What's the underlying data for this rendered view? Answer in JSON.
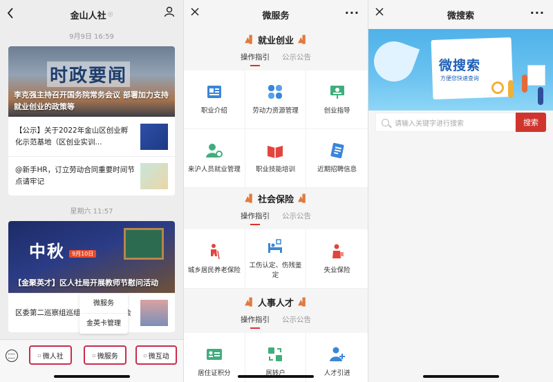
{
  "panel1": {
    "title": "金山人社",
    "time1": "9月9日 16:59",
    "hero1": {
      "big_text": "时政要闻",
      "title": "李克强主持召开国务院常务会议 部署加力支持就业创业的政策等"
    },
    "news1": [
      {
        "text": "【公示】关于2022年金山区创业孵化示范基地（区创业实训..."
      },
      {
        "text": "@新手HR，订立劳动合同重要时间节点请牢记"
      }
    ],
    "time2": "星期六 11:57",
    "hero2": {
      "big_text": "中秋",
      "tag": "9月10日",
      "title": "【金聚英才】区人社局开展教师节慰问活动"
    },
    "news2": [
      {
        "text": "区委第二巡察组巡组工作情况汇报会"
      }
    ],
    "popup": [
      "微服务",
      "金英卡管理"
    ],
    "menu": [
      "微人社",
      "微服务",
      "微互动"
    ]
  },
  "panel2": {
    "title": "微服务",
    "sections": [
      {
        "title": "就业创业",
        "tabs": [
          "操作指引",
          "公示公告"
        ],
        "items": [
          "职业介绍",
          "劳动力资源管理",
          "创业指导",
          "来沪人员就业管理",
          "职业技能培训",
          "近期招聘信息"
        ]
      },
      {
        "title": "社会保险",
        "tabs": [
          "操作指引",
          "公示公告"
        ],
        "items": [
          "城乡居民养老保险",
          "工伤认定、伤残鉴定",
          "失业保险"
        ]
      },
      {
        "title": "人事人才",
        "tabs": [
          "操作指引",
          "公示公告"
        ],
        "items": [
          "居住证积分",
          "居转户",
          "人才引进"
        ]
      }
    ]
  },
  "panel3": {
    "title": "微搜索",
    "banner_title": "微搜索",
    "banner_subtitle": "方便您快速查询",
    "search_placeholder": "请输入关键字进行搜索",
    "search_button": "搜索"
  },
  "colors": {
    "accent_red": "#d0352d",
    "highlight_border": "#c92b4b",
    "icon_blue": "#3a86d8",
    "icon_green": "#3fae7c",
    "icon_red": "#e0453e"
  }
}
